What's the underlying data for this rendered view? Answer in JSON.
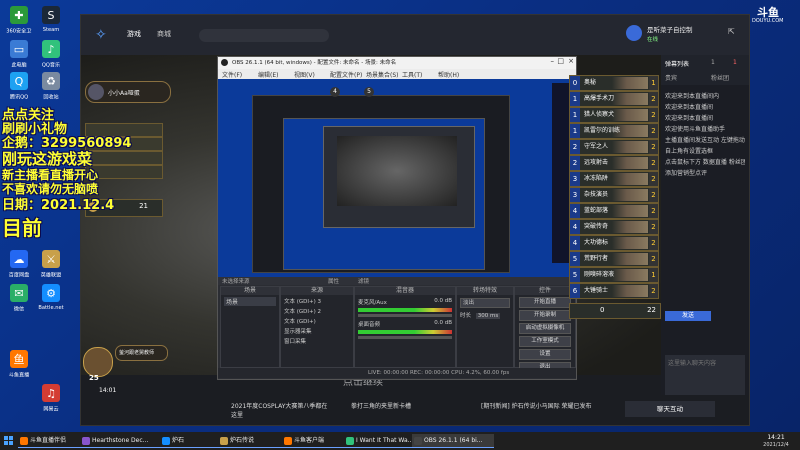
{
  "desktop": {
    "icons": [
      {
        "label": "360安全卫士",
        "color": "#2b9a3a",
        "glyph": "✚"
      },
      {
        "label": "Steam",
        "color": "#1b2838",
        "glyph": "S"
      },
      {
        "label": "此电脑",
        "color": "#3a7bd5",
        "glyph": "▭"
      },
      {
        "label": "QQ音乐",
        "color": "#31c27c",
        "glyph": "♪"
      },
      {
        "label": "腾讯QQ",
        "color": "#1da1f2",
        "glyph": "Q"
      },
      {
        "label": "回收站",
        "color": "#7a8aa0",
        "glyph": "♻"
      },
      {
        "label": "百度网盘",
        "color": "#2468f2",
        "glyph": "☁"
      },
      {
        "label": "英雄联盟",
        "color": "#c8a04a",
        "glyph": "⚔"
      },
      {
        "label": "微信",
        "color": "#2aae67",
        "glyph": "✉"
      },
      {
        "label": "Battle.net",
        "color": "#148eff",
        "glyph": "⚙"
      },
      {
        "label": "斗鱼直播",
        "color": "#ff7700",
        "glyph": "鱼"
      },
      {
        "label": "网易云",
        "color": "#d43c33",
        "glyph": "♫"
      }
    ]
  },
  "douyu": {
    "nav": [
      "游戏",
      "商城"
    ],
    "user_name": "是听菜子自控制",
    "user_status": "在线",
    "brand": "斗鱼",
    "brand_sub": "DOUYU.COM",
    "tabs": [
      "弹幕列表",
      "贵宾",
      "粉丝团"
    ],
    "chat_count": "1",
    "likes": "1",
    "chat_lines": [
      "欢迎来到本直播间内",
      "欢迎来到本直播间",
      "欢迎来到本直播间",
      "欢迎使用斗鱼直播助手",
      "主播直播间发送互动 左键拖动图框改变大小",
      "自上角有设置选框",
      "点击鼠标下方 数据直播 粉丝团有",
      "添加营销型点评"
    ],
    "send_label": "发送",
    "chat_placeholder": "这里输入聊天内容",
    "send_button": "聊天互动",
    "bottom_tiles": [
      "2021年度COSPLAY大赛第八季都在这里",
      "拳打三角的夹里新卡槽",
      "[期刊新闻] 炉石传说小马国际 荣耀已发布"
    ],
    "player_time": "14:01",
    "player_watermark": "点击继续",
    "streamer_left": "小小Aa哑蛋",
    "streamer_bottom": "萤河跟老舅教师",
    "fps_label": "FPS"
  },
  "overlay": {
    "line1": "点点关注",
    "line2": "刷刷小礼物",
    "line3": "企鹅：3299560894",
    "line4": "刚玩这游戏菜",
    "line5": "新主播看直播开心",
    "line6": "不喜欢请勿无脑喷",
    "line7": "日期：2021.12.4",
    "line8": "目前"
  },
  "hearthstone": {
    "deck": [
      {
        "cost": "0",
        "name": "奥秘",
        "qty": "1"
      },
      {
        "cost": "1",
        "name": "高爆手术刀",
        "qty": "2"
      },
      {
        "cost": "1",
        "name": "猎人侦察犬",
        "qty": "2"
      },
      {
        "cost": "1",
        "name": "凯雷尔的训练",
        "qty": "2"
      },
      {
        "cost": "2",
        "name": "守军之人",
        "qty": "2"
      },
      {
        "cost": "2",
        "name": "远攻射击",
        "qty": "2"
      },
      {
        "cost": "3",
        "name": "冰冻陷阱",
        "qty": "2"
      },
      {
        "cost": "3",
        "name": "杂技演员",
        "qty": "2"
      },
      {
        "cost": "4",
        "name": "蓝蛇部落",
        "qty": "2"
      },
      {
        "cost": "4",
        "name": "突破传奇",
        "qty": "2"
      },
      {
        "cost": "4",
        "name": "大功德标",
        "qty": "2"
      },
      {
        "cost": "5",
        "name": "荒野行者",
        "qty": "2"
      },
      {
        "cost": "5",
        "name": "刚嗅碎溶液",
        "qty": "1"
      },
      {
        "cost": "6",
        "name": "大锤骑士",
        "qty": "2"
      }
    ],
    "deck_counter_left": "0",
    "deck_counter_right": "22",
    "hand_left": "21",
    "hp": "25",
    "mana_left": "4",
    "mana_right": "5"
  },
  "obs": {
    "title": "OBS 26.1.1 (64 bit, windows) - 配置文件: 未命名 - 场景: 未命名",
    "menu": [
      "文件(F)",
      "编辑(E)",
      "视图(V)",
      "配置文件(P)",
      "场景集合(S)",
      "工具(T)",
      "帮助(H)"
    ],
    "scenes_header": "场景",
    "scenes": [
      "场景"
    ],
    "sources_header": "来源",
    "sources": [
      "文本 (GDI+) 3",
      "文本 (GDI+) 2",
      "文本 (GDI+)",
      "显示器采集",
      "窗口采集"
    ],
    "mixer_header": "混音器",
    "mixer": [
      {
        "label": "麦克风/Aux",
        "level": "0.0 dB"
      },
      {
        "label": "桌面音频",
        "level": "0.0 dB"
      }
    ],
    "transitions_header": "转场特效",
    "transition": "淡出",
    "duration_label": "时长",
    "duration": "300 ms",
    "controls_header": "控件",
    "controls": [
      "开始直播",
      "开始录制",
      "启动虚拟摄像机",
      "工作室模式",
      "设置",
      "退出"
    ],
    "status": "LIVE: 00:00:00   REC: 00:00:00   CPU: 4.2%, 60.00 fps",
    "scene_label": "未选择来源",
    "properties": "属性",
    "filters": "滤镜"
  },
  "taskbar": {
    "items": [
      {
        "label": "斗鱼直播伴侣",
        "color": "#ff7700"
      },
      {
        "label": "Hearthstone Dec...",
        "color": "#8855cc"
      },
      {
        "label": "炉石",
        "color": "#148eff"
      },
      {
        "label": "炉石传说",
        "color": "#c8a04a"
      },
      {
        "label": "斗鱼客户端",
        "color": "#ff7700"
      },
      {
        "label": "I Want It That Wa...",
        "color": "#31c27c"
      },
      {
        "label": "OBS 26.1.1 (64 bi...",
        "color": "#444"
      }
    ],
    "time": "14:21",
    "date": "2021/12/4"
  }
}
